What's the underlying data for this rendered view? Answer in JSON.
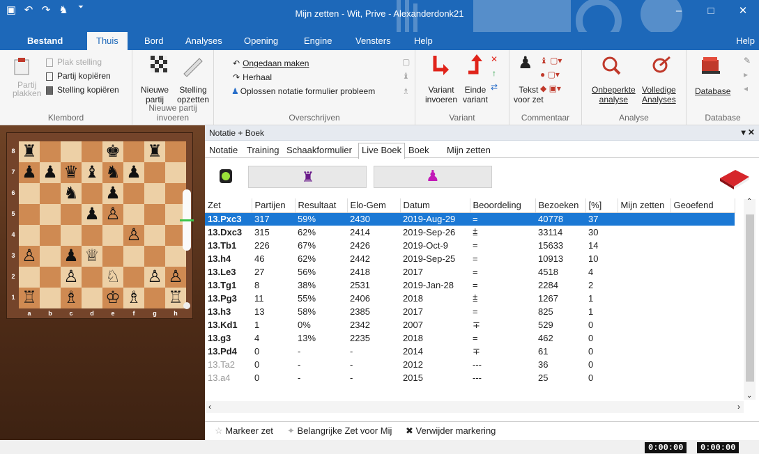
{
  "window": {
    "title": "Mijn zetten - Wit, Prive - Alexanderdonk21",
    "minimize": "–",
    "maximize": "□",
    "close": "✕"
  },
  "qat": [
    "▣",
    "↶",
    "↷",
    "♞",
    "⏷"
  ],
  "menu": {
    "tabs": [
      "Bestand",
      "Thuis",
      "Bord",
      "Analyses",
      "Opening",
      "Engine",
      "Vensters",
      "Help"
    ],
    "active": "Thuis",
    "help_right": "Help"
  },
  "ribbon": {
    "klembord": {
      "label": "Klembord",
      "partij_plakken": "Partij\nplakken",
      "plak_stelling": "Plak stelling",
      "partij_kopieren": "Partij kopiëren",
      "stelling_kopieren": "Stelling kopiëren"
    },
    "nieuw": {
      "label": "Nieuwe partij invoeren",
      "nieuwe_partij": "Nieuwe\npartij",
      "stelling_opzetten": "Stelling\nopzetten"
    },
    "overschrijven": {
      "label": "Overschrijven",
      "ongedaan": "Ongedaan maken",
      "herhaal": "Herhaal",
      "oplossen": "Oplossen notatie formulier probleem"
    },
    "variant": {
      "label": "Variant",
      "invoeren": "Variant\ninvoeren",
      "einde": "Einde\nvariant"
    },
    "commentaar": {
      "label": "Commentaar",
      "tekst": "Tekst\nvoor zet"
    },
    "analyse": {
      "label": "Analyse",
      "onbeperkte": "Onbeperkte\nanalyse",
      "volledige": "Volledige\nAnalyses"
    },
    "database": {
      "label": "Database",
      "database": "Database"
    }
  },
  "board": {
    "ranks": [
      "8",
      "7",
      "6",
      "5",
      "4",
      "3",
      "2",
      "1"
    ],
    "files": [
      "a",
      "b",
      "c",
      "d",
      "e",
      "f",
      "g",
      "h"
    ],
    "rows": [
      [
        "♜",
        "",
        "",
        "",
        "♚",
        "",
        "♜",
        ""
      ],
      [
        "♟",
        "♟",
        "♛",
        "♝",
        "♞",
        "♟",
        "",
        ""
      ],
      [
        "",
        "",
        "♞",
        "",
        "♟",
        "",
        "",
        ""
      ],
      [
        "",
        "",
        "",
        "♟",
        "♙",
        "",
        "",
        ""
      ],
      [
        "",
        "",
        "",
        "",
        "",
        "♙",
        "",
        ""
      ],
      [
        "♙",
        "",
        "♟",
        "♕",
        "",
        "",
        "",
        ""
      ],
      [
        "",
        "",
        "♙",
        "",
        "♘",
        "",
        "♙",
        "♙"
      ],
      [
        "♖",
        "",
        "♗",
        "",
        "♔",
        "♗",
        "",
        "♖"
      ]
    ]
  },
  "panel": {
    "title": "Notatie + Boek",
    "close": "▾ ✕",
    "tabs": [
      "Notatie",
      "Training",
      "Schaakformulier",
      "Live Boek",
      "Boek",
      "Mijn zetten"
    ],
    "active_tab": "Live Boek"
  },
  "table": {
    "headers": [
      "Zet",
      "Partijen",
      "Resultaat",
      "Elo-Gem",
      "Datum",
      "Beoordeling",
      "Bezoeken",
      "[%]",
      "Mijn zetten",
      "Geoefend"
    ],
    "rows": [
      [
        "13.Pxc3",
        "317",
        "59%",
        "2430",
        "2019-Aug-29",
        "=",
        "40778",
        "37",
        "",
        ""
      ],
      [
        "13.Dxc3",
        "315",
        "62%",
        "2414",
        "2019-Sep-26",
        "⩲",
        "33114",
        "30",
        "",
        ""
      ],
      [
        "13.Tb1",
        "226",
        "67%",
        "2426",
        "2019-Oct-9",
        "=",
        "15633",
        "14",
        "",
        ""
      ],
      [
        "13.h4",
        "46",
        "62%",
        "2442",
        "2019-Sep-25",
        "=",
        "10913",
        "10",
        "",
        ""
      ],
      [
        "13.Le3",
        "27",
        "56%",
        "2418",
        "2017",
        "=",
        "4518",
        "4",
        "",
        ""
      ],
      [
        "13.Tg1",
        "8",
        "38%",
        "2531",
        "2019-Jan-28",
        "=",
        "2284",
        "2",
        "",
        ""
      ],
      [
        "13.Pg3",
        "11",
        "55%",
        "2406",
        "2018",
        "⩲",
        "1267",
        "1",
        "",
        ""
      ],
      [
        "13.h3",
        "13",
        "58%",
        "2385",
        "2017",
        "=",
        "825",
        "1",
        "",
        ""
      ],
      [
        "13.Kd1",
        "1",
        "0%",
        "2342",
        "2007",
        "∓",
        "529",
        "0",
        "",
        ""
      ],
      [
        "13.g3",
        "4",
        "13%",
        "2235",
        "2018",
        "=",
        "462",
        "0",
        "",
        ""
      ],
      [
        "13.Pd4",
        "0",
        "-",
        "-",
        "2014",
        "∓",
        "61",
        "0",
        "",
        ""
      ],
      [
        "13.Ta2",
        "0",
        "-",
        "-",
        "2012",
        "---",
        "36",
        "0",
        "",
        ""
      ],
      [
        "13.a4",
        "0",
        "-",
        "-",
        "2015",
        "---",
        "25",
        "0",
        "",
        ""
      ]
    ]
  },
  "markbar": {
    "markeer": "Markeer zet",
    "belangrijk": "Belangrijke Zet voor Mij",
    "verwijder": "Verwijder markering"
  },
  "status": {
    "clock1": "0:00:00",
    "clock2": "0:00:00"
  },
  "colors": {
    "accent": "#1d68b9",
    "selection": "#1b78d4",
    "variant_red": "#e0241b"
  }
}
